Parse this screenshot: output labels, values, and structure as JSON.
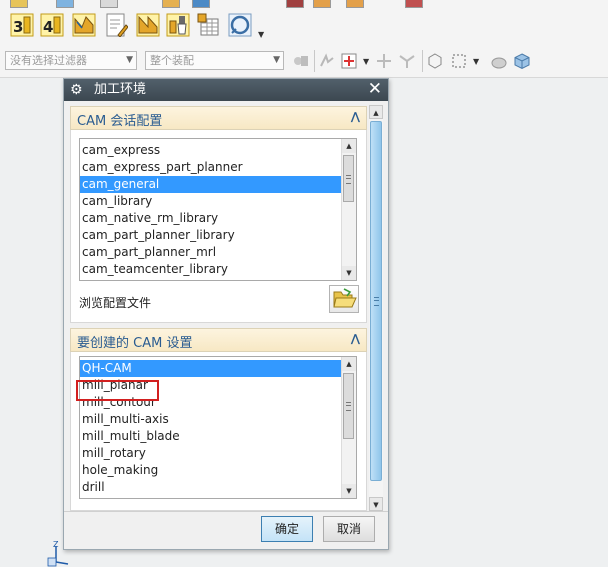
{
  "toolbar": {
    "top_cut_icon_names": [
      "cut-icon-1",
      "cut-icon-2",
      "cut-icon-3",
      "cut-icon-4",
      "cut-icon-5",
      "cut-icon-6",
      "cut-icon-7",
      "cut-icon-8"
    ],
    "row2_icons": [
      {
        "name": "3-axis-icon",
        "text": "3"
      },
      {
        "name": "4-axis-icon",
        "text": "4"
      },
      {
        "name": "contour-icon",
        "text": ""
      },
      {
        "name": "edit-document-icon",
        "text": ""
      },
      {
        "name": "planar-mill-icon",
        "text": ""
      },
      {
        "name": "brush-icon",
        "text": ""
      },
      {
        "name": "table-icon",
        "text": ""
      },
      {
        "name": "ring-icon",
        "text": ""
      }
    ],
    "filter_combo": {
      "placeholder": "没有选择过滤器"
    },
    "assembly_combo": {
      "placeholder": "整个装配"
    }
  },
  "dialog": {
    "title": "加工环境",
    "session_section": {
      "label": "CAM 会话配置",
      "items": [
        "cam_express",
        "cam_express_part_planner",
        "cam_general",
        "cam_library",
        "cam_native_rm_library",
        "cam_part_planner_library",
        "cam_part_planner_mrl",
        "cam_teamcenter_library"
      ],
      "selected_index": 2,
      "browse_label": "浏览配置文件"
    },
    "setup_section": {
      "label": "要创建的 CAM 设置",
      "items": [
        "QH-CAM",
        "mill_planar",
        "mill_contour",
        "mill_multi-axis",
        "mill_multi_blade",
        "mill_rotary",
        "hole_making",
        "drill"
      ],
      "selected_index": 0
    },
    "ok_label": "确定",
    "cancel_label": "取消"
  },
  "colors": {
    "selection": "#3399ff",
    "section_label": "#2a5c91",
    "highlight_box": "#d21f1f",
    "titlebar": "#3c4750"
  }
}
